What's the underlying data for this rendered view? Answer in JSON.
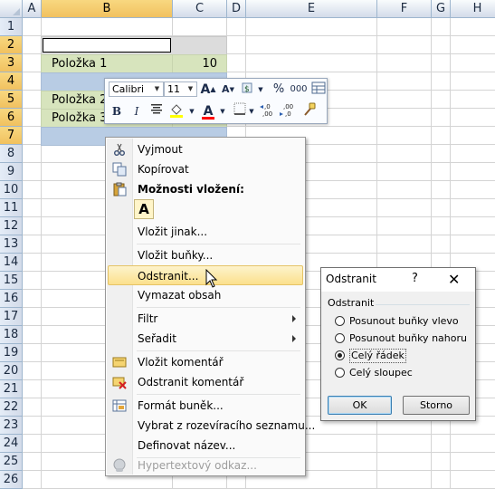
{
  "columns": [
    "A",
    "B",
    "C",
    "D",
    "E",
    "F",
    "G",
    "H"
  ],
  "rows": [
    "1",
    "2",
    "3",
    "4",
    "5",
    "6",
    "7",
    "8",
    "9",
    "10",
    "11",
    "12",
    "13",
    "14",
    "15",
    "16",
    "17",
    "18",
    "19",
    "20",
    "21",
    "22",
    "23",
    "24",
    "25",
    "26"
  ],
  "cells": {
    "b3": "Položka 1",
    "c3": "10",
    "b5": "Položka 2",
    "b6": "Položka 3"
  },
  "mini_toolbar": {
    "font": "Calibri",
    "size": "11",
    "percent": "%",
    "thousands": "000",
    "bold": "B",
    "italic": "I",
    "grow_font": "A",
    "shrink_font": "A",
    "font_color_letter": "A",
    "font_color": "#ff0000",
    "fill_color": "#ffff00"
  },
  "context_menu": {
    "cut": "Vyjmout",
    "copy": "Kopírovat",
    "paste_options": "Možnosti vložení:",
    "paste_tile": "A",
    "paste_special": "Vložit jinak...",
    "insert_cells": "Vložit buňky...",
    "delete": "Odstranit...",
    "clear": "Vymazat obsah",
    "filter": "Filtr",
    "sort": "Seřadit",
    "insert_comment": "Vložit komentář",
    "delete_comment": "Odstranit komentář",
    "format_cells": "Formát buněk...",
    "pick_list": "Vybrat z rozevíracího seznamu...",
    "define_name": "Definovat název...",
    "hyperlink": "Hypertextový odkaz..."
  },
  "dialog": {
    "title": "Odstranit",
    "help": "?",
    "close": "✕",
    "group": "Odstranit",
    "options": [
      "Posunout buňky vlevo",
      "Posunout buňky nahoru",
      "Celý řádek",
      "Celý sloupec"
    ],
    "selected": "Celý řádek",
    "ok": "OK",
    "cancel": "Storno"
  },
  "colors": {
    "header_selected": "#f1c15f",
    "green_fill": "#d7e4bd",
    "blue_fill": "#b8cce4",
    "menu_highlight": "#fbe08c"
  }
}
